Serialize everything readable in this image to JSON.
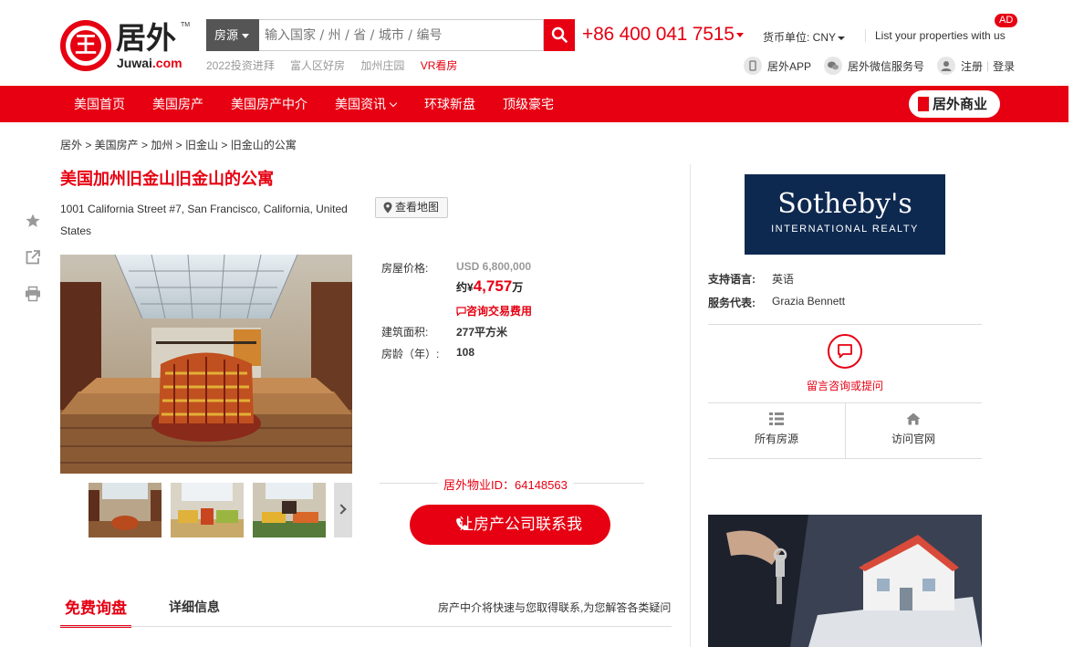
{
  "brand": {
    "name_cn": "居外",
    "name_en": "Juwai",
    "name_en_domain": ".com",
    "tm": "TM"
  },
  "search": {
    "type_label": "房源",
    "placeholder": "输入国家 / 州 / 省 / 城市 / 编号",
    "hot_links": [
      "2022投资进拜",
      "富人区好房",
      "加州庄园",
      "VR看房"
    ]
  },
  "header": {
    "phone": "+86 400 041 7515",
    "currency_label": "货币单位: CNY",
    "list_properties": "List your properties with us",
    "ad_badge": "AD",
    "app_link": "居外APP",
    "wechat_link": "居外微信服务号",
    "register": "注册",
    "login": "登录"
  },
  "nav": {
    "items": [
      "美国首页",
      "美国房产",
      "美国房产中介",
      "美国资讯",
      "环球新盘",
      "顶级豪宅"
    ],
    "biz_button": "居外商业"
  },
  "breadcrumb": "居外 > 美国房产 > 加州 > 旧金山 > 旧金山的公寓",
  "property": {
    "title": "美国加州旧金山旧金山的公寓",
    "address": "1001 California Street #7, San Francisco, California, United States",
    "map_button": "查看地图",
    "price_label": "房屋价格:",
    "price_usd": "USD 6,800,000",
    "price_cny_prefix": "约¥",
    "price_cny_amount": "4,757",
    "price_cny_unit": "万",
    "consult_fee": "咨询交易费用",
    "area_label": "建筑面积:",
    "area_value": "277平方米",
    "age_label": "房龄（年）:",
    "age_value": "108",
    "id_text": "居外物业ID：64148563",
    "contact_button": "让房产公司联系我"
  },
  "tabs": {
    "active": "免费询盘",
    "detail": "详细信息",
    "note": "房产中介将快速与您取得联系,为您解答各类疑问"
  },
  "agent": {
    "logo_name": "Sotheby's",
    "logo_sub": "INTERNATIONAL REALTY",
    "language_label": "支持语言:",
    "language_value": "英语",
    "rep_label": "服务代表:",
    "rep_value": "Grazia Bennett",
    "message_label": "留言咨询或提问",
    "all_listings": "所有房源",
    "website": "访问官网"
  },
  "colors": {
    "accent": "#e60012",
    "sotheby_navy": "#0e2950"
  }
}
